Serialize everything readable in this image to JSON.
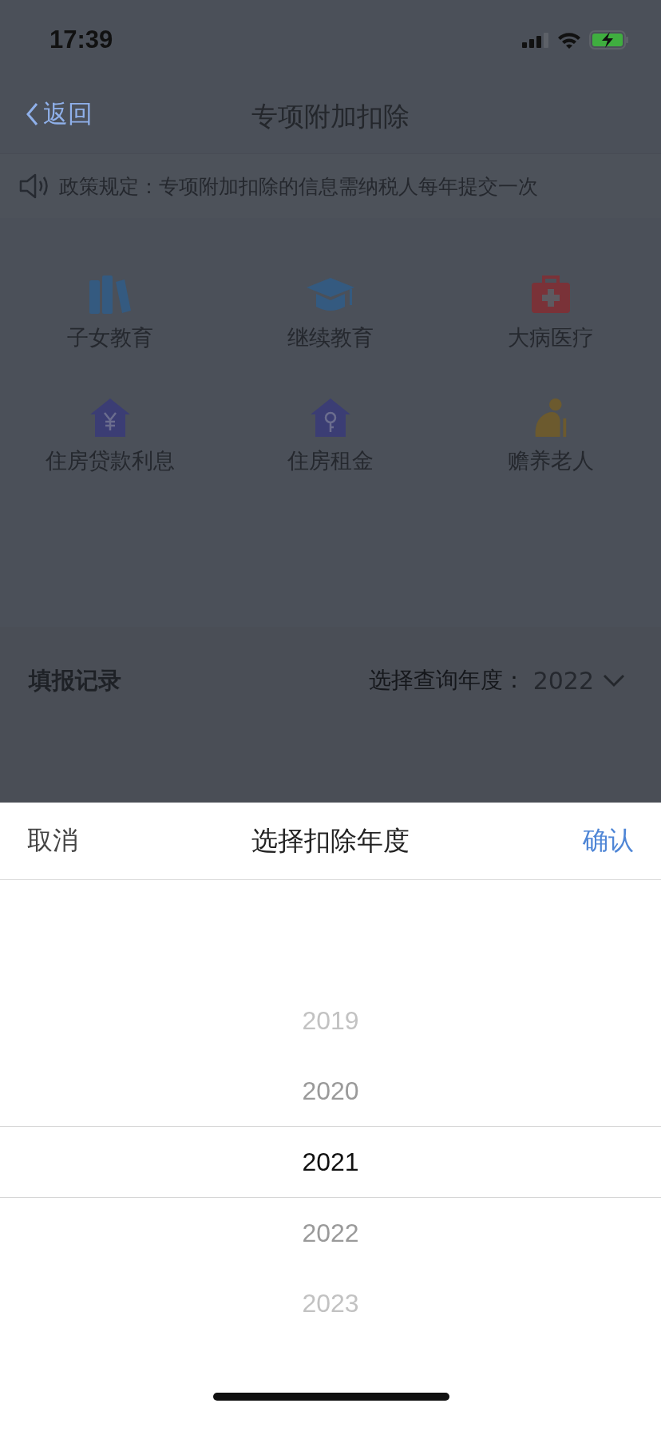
{
  "status_bar": {
    "time": "17:39"
  },
  "nav": {
    "back": "返回",
    "title": "专项附加扣除"
  },
  "notice": {
    "text": "政策规定：专项附加扣除的信息需纳税人每年提交一次"
  },
  "categories": [
    {
      "label": "子女教育",
      "kind": "books"
    },
    {
      "label": "继续教育",
      "kind": "cap"
    },
    {
      "label": "大病医疗",
      "kind": "medkit"
    },
    {
      "label": "住房贷款利息",
      "kind": "house-yen"
    },
    {
      "label": "住房租金",
      "kind": "house-key"
    },
    {
      "label": "赡养老人",
      "kind": "elder"
    }
  ],
  "records": {
    "title": "填报记录",
    "filter_label": "选择查询年度：",
    "filter_value": "2022"
  },
  "sheet": {
    "cancel": "取消",
    "title": "选择扣除年度",
    "confirm": "确认",
    "years": [
      {
        "label": "2019",
        "selected": false
      },
      {
        "label": "2020",
        "selected": false
      },
      {
        "label": "2021",
        "selected": true
      },
      {
        "label": "2022",
        "selected": false
      },
      {
        "label": "2023",
        "selected": false
      }
    ]
  }
}
